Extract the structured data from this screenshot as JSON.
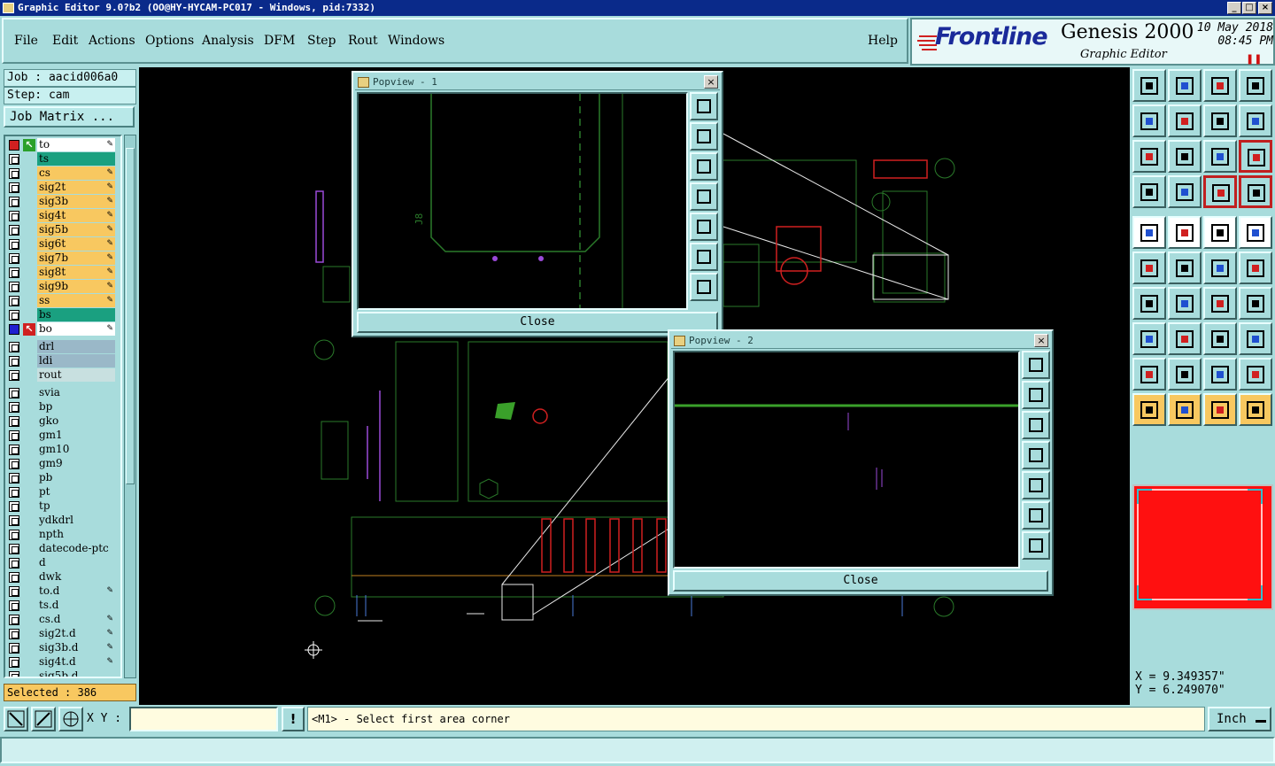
{
  "window": {
    "title": "Graphic Editor 9.0?b2 (OO@HY-HYCAM-PC017 - Windows, pid:7332)"
  },
  "menu": {
    "items": [
      "File",
      "Edit",
      "Actions",
      "Options",
      "Analysis",
      "DFM",
      "Step",
      "Rout",
      "Windows"
    ],
    "help": "Help"
  },
  "brand": {
    "logo": "Frontline",
    "product": "Genesis 2000",
    "subtitle": "Graphic Editor",
    "date": "10 May 2018",
    "time": "08:45 PM"
  },
  "job": {
    "job_label": "Job : aacid006a0",
    "step_label": "Step: cam",
    "matrix_button": "Job Matrix ..."
  },
  "layers": [
    {
      "name": "to",
      "color": "#ffffff",
      "state": "red",
      "arrow": "green",
      "pen": true
    },
    {
      "name": "ts",
      "color": "#1aa080",
      "state": "off"
    },
    {
      "name": "cs",
      "color": "#f8c860",
      "state": "off",
      "pen": true
    },
    {
      "name": "sig2t",
      "color": "#f8c860",
      "state": "off",
      "pen": true
    },
    {
      "name": "sig3b",
      "color": "#f8c860",
      "state": "off",
      "pen": true
    },
    {
      "name": "sig4t",
      "color": "#f8c860",
      "state": "off",
      "pen": true
    },
    {
      "name": "sig5b",
      "color": "#f8c860",
      "state": "off",
      "pen": true
    },
    {
      "name": "sig6t",
      "color": "#f8c860",
      "state": "off",
      "pen": true
    },
    {
      "name": "sig7b",
      "color": "#f8c860",
      "state": "off",
      "pen": true
    },
    {
      "name": "sig8t",
      "color": "#f8c860",
      "state": "off",
      "pen": true
    },
    {
      "name": "sig9b",
      "color": "#f8c860",
      "state": "off",
      "pen": true
    },
    {
      "name": "ss",
      "color": "#f8c860",
      "state": "off",
      "pen": true
    },
    {
      "name": "bs",
      "color": "#1aa080",
      "state": "off"
    },
    {
      "name": "bo",
      "color": "#ffffff",
      "state": "blue",
      "arrow": "red",
      "pen": true
    },
    {
      "name": "drl",
      "color": "#9ab8c8",
      "state": "off"
    },
    {
      "name": "ldi",
      "color": "#9ab8c8",
      "state": "off"
    },
    {
      "name": "rout",
      "color": "#c8e0e0",
      "state": "off"
    },
    {
      "name": "svia",
      "color": "#a8dcdc",
      "state": "off"
    },
    {
      "name": "bp",
      "color": "#a8dcdc",
      "state": "off"
    },
    {
      "name": "gko",
      "color": "#a8dcdc",
      "state": "off"
    },
    {
      "name": "gm1",
      "color": "#a8dcdc",
      "state": "off"
    },
    {
      "name": "gm10",
      "color": "#a8dcdc",
      "state": "off"
    },
    {
      "name": "gm9",
      "color": "#a8dcdc",
      "state": "off"
    },
    {
      "name": "pb",
      "color": "#a8dcdc",
      "state": "off"
    },
    {
      "name": "pt",
      "color": "#a8dcdc",
      "state": "off"
    },
    {
      "name": "tp",
      "color": "#a8dcdc",
      "state": "off"
    },
    {
      "name": "ydkdrl",
      "color": "#a8dcdc",
      "state": "off"
    },
    {
      "name": "npth",
      "color": "#a8dcdc",
      "state": "off"
    },
    {
      "name": "datecode-ptc",
      "color": "#a8dcdc",
      "state": "off"
    },
    {
      "name": "d",
      "color": "#a8dcdc",
      "state": "off"
    },
    {
      "name": "dwk",
      "color": "#a8dcdc",
      "state": "off"
    },
    {
      "name": "to.d",
      "color": "#a8dcdc",
      "state": "off",
      "pen": true
    },
    {
      "name": "ts.d",
      "color": "#a8dcdc",
      "state": "off"
    },
    {
      "name": "cs.d",
      "color": "#a8dcdc",
      "state": "off",
      "pen": true
    },
    {
      "name": "sig2t.d",
      "color": "#a8dcdc",
      "state": "off",
      "pen": true
    },
    {
      "name": "sig3b.d",
      "color": "#a8dcdc",
      "state": "off",
      "pen": true
    },
    {
      "name": "sig4t.d",
      "color": "#a8dcdc",
      "state": "off",
      "pen": true
    },
    {
      "name": "sig5b.d",
      "color": "#a8dcdc",
      "state": "off"
    }
  ],
  "selected": "Selected : 386",
  "popview1": {
    "title": "Popview - 1",
    "close": "Close",
    "ref_label": "J8"
  },
  "popview2": {
    "title": "Popview - 2",
    "close": "Close"
  },
  "coords": {
    "x": "X = 9.349357\"",
    "y": "Y = 6.249070\""
  },
  "bottom": {
    "xy_label": "X Y :",
    "xy_value": "",
    "warn": "!",
    "prompt": "<M1> - Select first area corner",
    "units": "Inch"
  },
  "colors": {
    "accent": "#a8dcdc",
    "titlebar": "#0a2a8a",
    "selected": "#f8c860",
    "mini_view": "#ff1010"
  }
}
